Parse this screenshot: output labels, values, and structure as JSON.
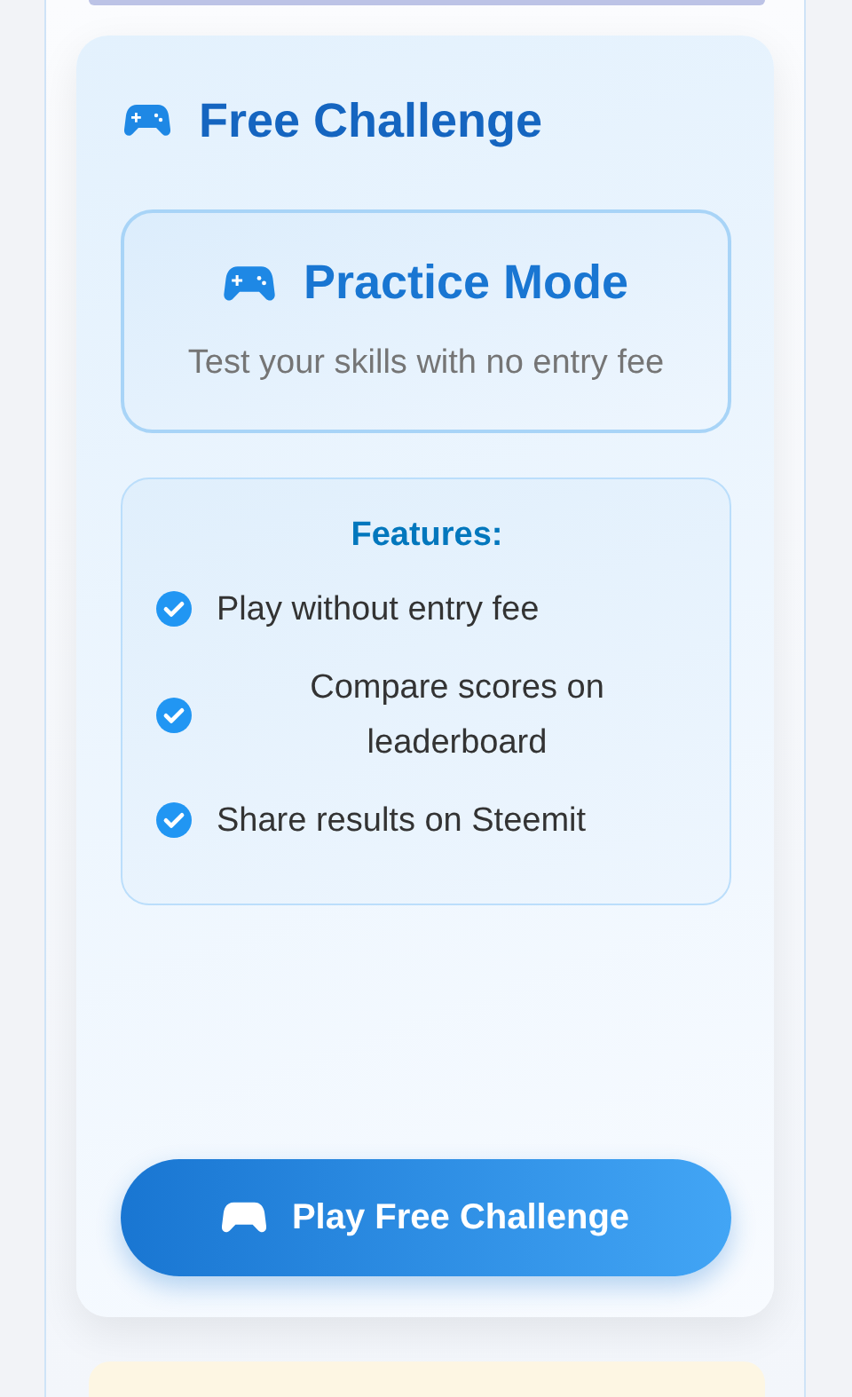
{
  "section": {
    "title": "Free Challenge"
  },
  "mode": {
    "title": "Practice Mode",
    "description": "Test your skills with no entry fee"
  },
  "features": {
    "heading": "Features:",
    "items": [
      "Play without entry fee",
      "Compare scores on leaderboard",
      "Share results on Steemit"
    ]
  },
  "button": {
    "label": "Play Free Challenge"
  }
}
